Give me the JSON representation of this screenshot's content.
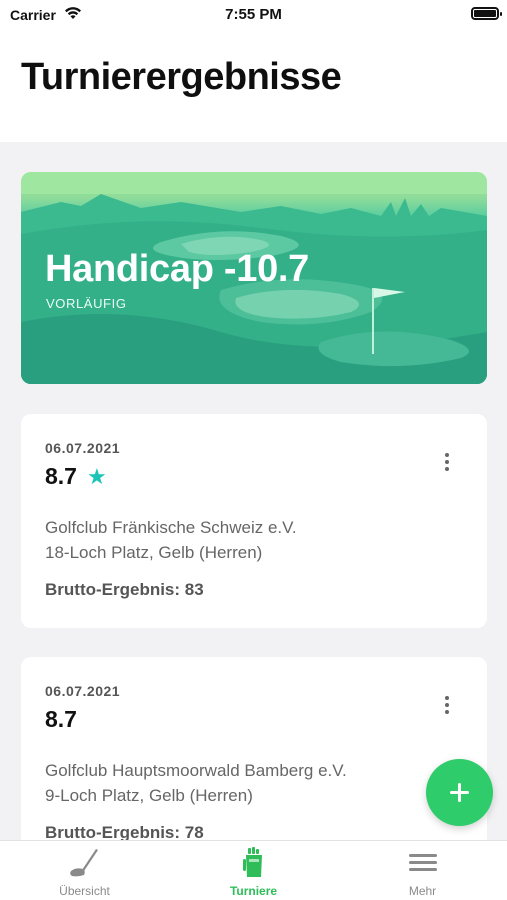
{
  "status_bar": {
    "carrier": "Carrier",
    "time": "7:55 PM"
  },
  "page": {
    "title": "Turnierergebnisse"
  },
  "hero": {
    "title": "Handicap -10.7",
    "subtitle": "VORLÄUFIG"
  },
  "results": [
    {
      "date": "06.07.2021",
      "score": "8.7",
      "starred": true,
      "club": "Golfclub Fränkische Schweiz e.V.",
      "course": "18-Loch Platz, Gelb (Herren)",
      "gross": "Brutto-Ergebnis: 83"
    },
    {
      "date": "06.07.2021",
      "score": "8.7",
      "starred": false,
      "club": "Golfclub Hauptsmoorwald Bamberg e.V.",
      "course": "9-Loch Platz, Gelb (Herren)",
      "gross": "Brutto-Ergebnis: 78"
    }
  ],
  "tabs": [
    {
      "label": "Übersicht",
      "icon": "golf-club-icon",
      "active": false
    },
    {
      "label": "Turniere",
      "icon": "golf-bag-icon",
      "active": true
    },
    {
      "label": "Mehr",
      "icon": "hamburger-menu-icon",
      "active": false
    }
  ],
  "colors": {
    "accent": "#2ecc6a",
    "star": "#1cc3b8",
    "hero_top": "#9be39a",
    "hero_bottom": "#2aa383"
  }
}
